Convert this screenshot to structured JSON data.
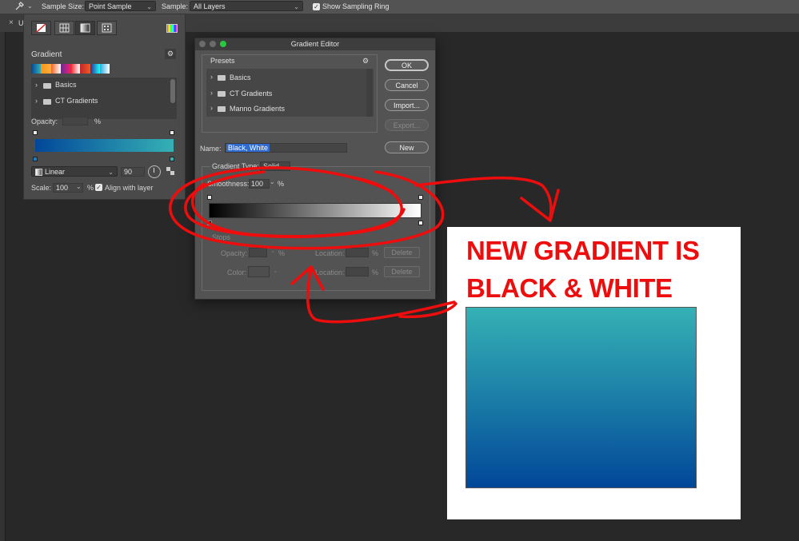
{
  "options_bar": {
    "sample_size_label": "Sample Size:",
    "sample_size_value": "Point Sample",
    "sample_label": "Sample:",
    "sample_value": "All Layers",
    "show_sampling_ring_label": "Show Sampling Ring",
    "show_sampling_ring_checked": true
  },
  "tabs": [
    {
      "label": "U",
      "close": "×"
    }
  ],
  "gradient_panel": {
    "title": "Gradient",
    "gear": "⚙",
    "presets": [
      {
        "label": "Basics"
      },
      {
        "label": "CT Gradients"
      }
    ],
    "opacity_label": "Opacity:",
    "opacity_unit": "%",
    "style_value": "Linear",
    "angle_value": "90",
    "scale_label": "Scale:",
    "scale_value": "100",
    "scale_unit": "%",
    "align_label": "Align with layer",
    "align_checked": true,
    "gradient_colors": [
      "#024799",
      "#35b1b5"
    ]
  },
  "editor": {
    "title": "Gradient Editor",
    "presets_label": "Presets",
    "presets": [
      {
        "label": "Basics"
      },
      {
        "label": "CT Gradients"
      },
      {
        "label": "Manno Gradients"
      }
    ],
    "buttons": {
      "ok": "OK",
      "cancel": "Cancel",
      "import": "Import...",
      "export": "Export...",
      "new": "New"
    },
    "name_label": "Name:",
    "name_value": "Black, White",
    "gradient_type_label": "Gradient Type:",
    "gradient_type_value": "Solid",
    "smoothness_label": "Smoothness:",
    "smoothness_value": "100",
    "smoothness_unit": "%",
    "stops_label": "Stops",
    "opacity_label": "Opacity:",
    "color_label": "Color:",
    "location_label": "Location:",
    "percent": "%",
    "delete_label": "Delete",
    "gradient_colors": [
      "#000000",
      "#ffffff"
    ]
  },
  "annotation": {
    "line1": "NEW GRADIENT IS",
    "line2": "BLACK & WHITE",
    "color": "#ee0d0d"
  },
  "canvas_gradient_colors": [
    "#35b1b5",
    "#024799"
  ]
}
